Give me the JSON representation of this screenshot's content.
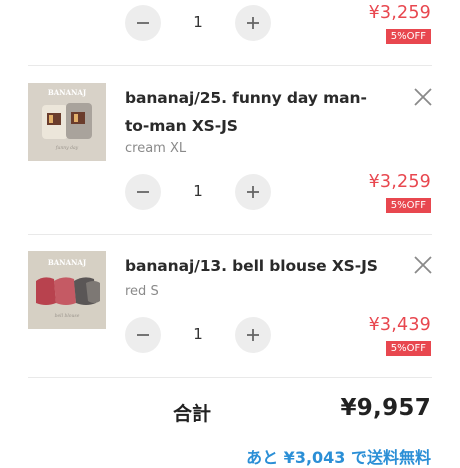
{
  "cart": {
    "items": [
      {
        "price": "¥3,259",
        "discount": "5%OFF",
        "quantity": "1"
      },
      {
        "title": "bananaj/25. funny day man-to-man XS-JS",
        "variant": "cream XL",
        "quantity": "1",
        "price": "¥3,259",
        "discount": "5%OFF",
        "image_brand": "BANANAJ"
      },
      {
        "title": "bananaj/13. bell blouse XS-JS",
        "variant": "red S",
        "quantity": "1",
        "price": "¥3,439",
        "discount": "5%OFF",
        "image_brand": "BANANAJ"
      }
    ]
  },
  "summary": {
    "total_label": "合計",
    "total_value": "¥9,957",
    "free_shipping_text": "あと ¥3,043 で送料無料"
  },
  "colors": {
    "accent_red": "#e8474f",
    "link_blue": "#2b8fd6",
    "button_gray": "#ededed"
  }
}
